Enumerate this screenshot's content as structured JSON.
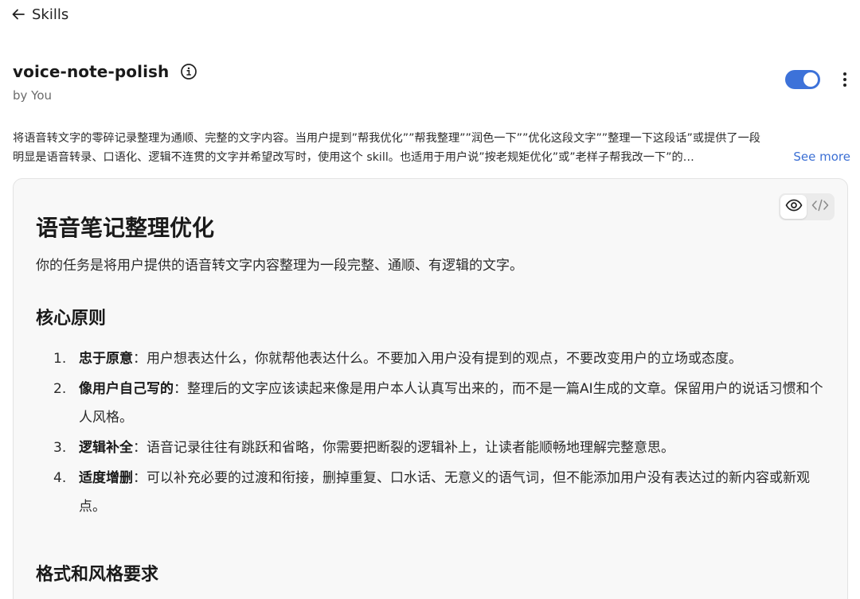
{
  "nav": {
    "back_label": "Skills"
  },
  "skill": {
    "name": "voice-note-polish",
    "byline": "by You",
    "enabled": true,
    "description_line1": "将语音转文字的零碎记录整理为通顺、完整的文字内容。当用户提到”帮我优化””帮我整理””润色一下””优化这段文字””整理一下这段话”或提供了一段",
    "description_line2": "明显是语音转录、口语化、逻辑不连贯的文字并希望改写时，使用这个 skill。也适用于用户说”按老规矩优化”或”老样子帮我改一下”的…",
    "see_more_label": "See more"
  },
  "view_switch": {
    "active": "preview",
    "options": [
      "eye-icon",
      "code-icon"
    ]
  },
  "document": {
    "title": "语音笔记整理优化",
    "intro": "你的任务是将用户提供的语音转文字内容整理为一段完整、通顺、有逻辑的文字。",
    "section1_title": "核心原则",
    "principles": [
      {
        "num": "1.",
        "term": "忠于原意",
        "text": "：用户想表达什么，你就帮他表达什么。不要加入用户没有提到的观点，不要改变用户的立场或态度。"
      },
      {
        "num": "2.",
        "term": "像用户自己写的",
        "text": "：整理后的文字应该读起来像是用户本人认真写出来的，而不是一篇AI生成的文章。保留用户的说话习惯和个人风格。"
      },
      {
        "num": "3.",
        "term": "逻辑补全",
        "text": "：语音记录往往有跳跃和省略，你需要把断裂的逻辑补上，让读者能顺畅地理解完整意思。"
      },
      {
        "num": "4.",
        "term": "适度增删",
        "text": "：可以补充必要的过渡和衔接，删掉重复、口水话、无意义的语气词，但不能添加用户没有表达过的新内容或新观点。"
      }
    ],
    "section2_title": "格式和风格要求"
  },
  "colors": {
    "accent": "#3d72d9",
    "link": "#3b6fd4",
    "card_bg": "#f8f8f8"
  }
}
